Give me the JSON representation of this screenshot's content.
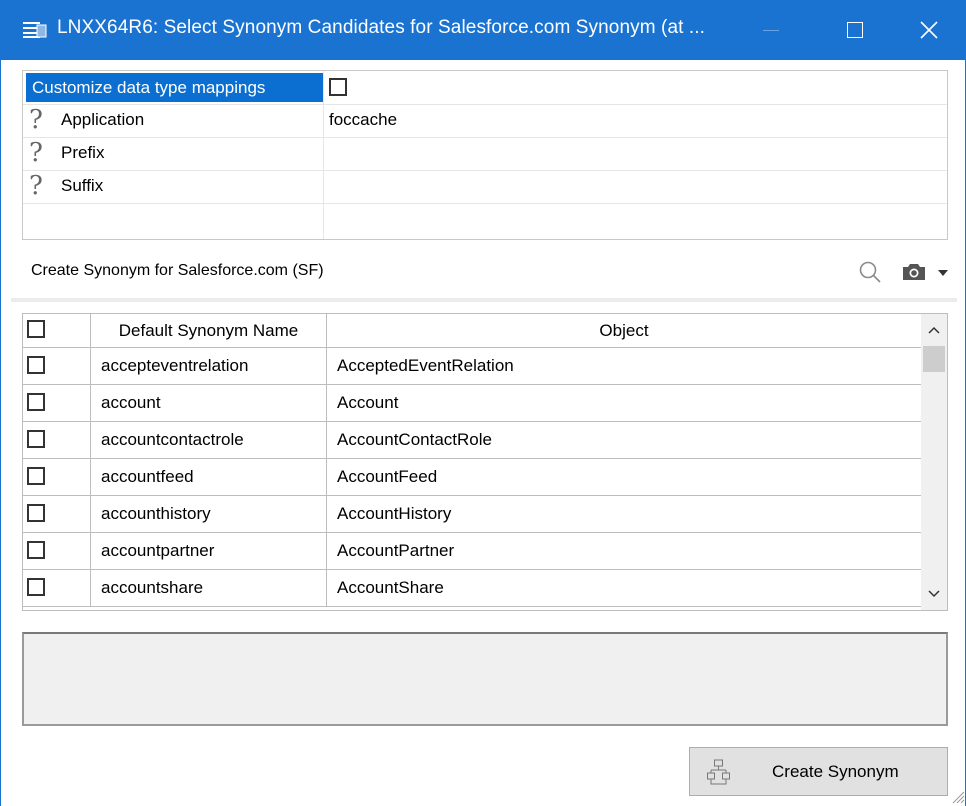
{
  "window": {
    "title": "LNXX64R6: Select Synonym Candidates for Salesforce.com Synonym (at ...",
    "accent_color": "#1a73d0",
    "controls": [
      "minimize-icon",
      "maximize-icon",
      "close-icon"
    ]
  },
  "properties": [
    {
      "label": "Customize data type mappings",
      "value": "",
      "checked": false,
      "selected": true
    },
    {
      "label": "Application",
      "value": "foccache",
      "icon": "question-icon"
    },
    {
      "label": "Prefix",
      "value": "",
      "icon": "question-icon"
    },
    {
      "label": "Suffix",
      "value": "",
      "icon": "question-icon"
    }
  ],
  "section": {
    "title": "Create Synonym for Salesforce.com (SF)",
    "icons": [
      "search-icon",
      "camera-icon",
      "dropdown-arrow-icon"
    ]
  },
  "table": {
    "columns": [
      "",
      "Default Synonym Name",
      "Object"
    ],
    "rows": [
      {
        "name": "accepteventrelation",
        "object": "AcceptedEventRelation",
        "checked": false
      },
      {
        "name": "account",
        "object": "Account",
        "checked": false
      },
      {
        "name": "accountcontactrole",
        "object": "AccountContactRole",
        "checked": false
      },
      {
        "name": "accountfeed",
        "object": "AccountFeed",
        "checked": false
      },
      {
        "name": "accounthistory",
        "object": "AccountHistory",
        "checked": false
      },
      {
        "name": "accountpartner",
        "object": "AccountPartner",
        "checked": false
      },
      {
        "name": "accountshare",
        "object": "AccountShare",
        "checked": false
      }
    ]
  },
  "description": "",
  "buttons": {
    "create": "Create Synonym"
  }
}
